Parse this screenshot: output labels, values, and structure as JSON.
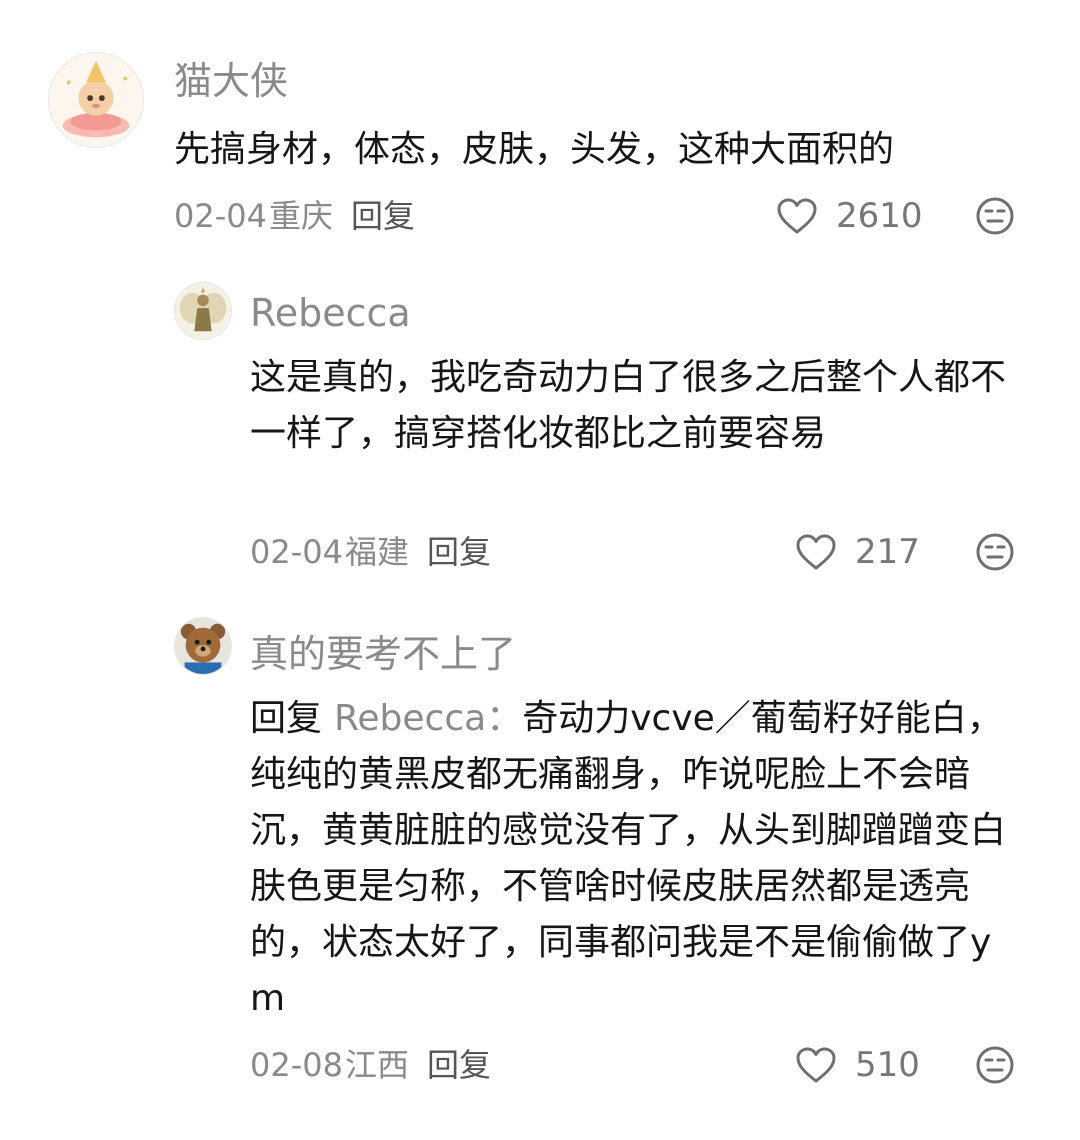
{
  "comments": [
    {
      "username": "猫大侠",
      "text": "先搞身材，体态，皮肤，头发，这种大面积的",
      "date": "02-04",
      "location": "重庆",
      "reply_label": "回复",
      "likes": "2610",
      "avatar_icon": "angel-baby-avatar"
    },
    {
      "username": "Rebecca",
      "text": "这是真的，我吃奇动力白了很多之后整个人都不一样了，搞穿搭化妆都比之前要容易",
      "date": "02-04",
      "location": "福建",
      "reply_label": "回复",
      "likes": "217",
      "avatar_icon": "fairy-avatar"
    },
    {
      "username": "真的要考不上了",
      "reply_prefix": "回复",
      "reply_to": "Rebecca：",
      "text": "奇动力vcve／葡萄籽好能白，纯纯的黄黑皮都无痛翻身，咋说呢脸上不会暗沉，黄黄脏脏的感觉没有了，从头到脚蹭蹭变白肤色更是匀称，不管啥时候皮肤居然都是透亮的，状态太好了，同事都问我是不是偷偷做了ym",
      "date": "02-08",
      "location": "江西",
      "reply_label": "回复",
      "likes": "510",
      "avatar_icon": "teddy-bear-avatar"
    }
  ],
  "icons": {
    "like": "heart-outline-icon",
    "emoji": "neutral-face-icon"
  },
  "colors": {
    "text": "#161616",
    "muted": "#8a8a8a",
    "icon": "#6f6f6f"
  }
}
